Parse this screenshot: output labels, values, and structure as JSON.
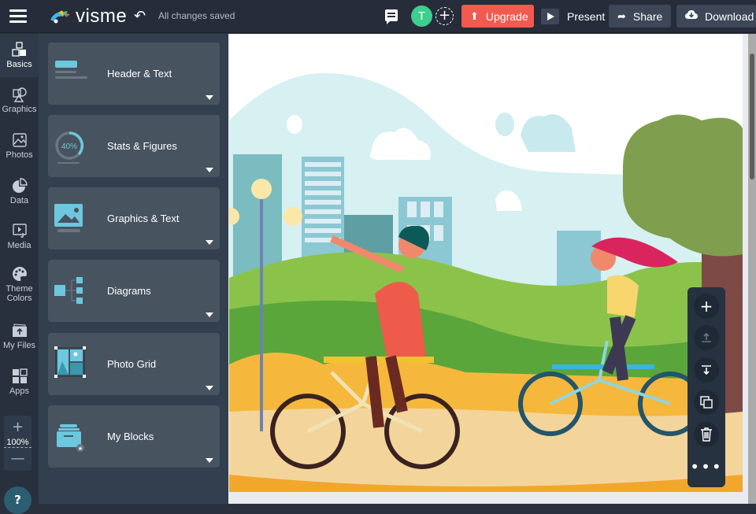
{
  "topbar": {
    "brand": "visme",
    "save_status": "All changes saved",
    "avatar_initial": "T",
    "buttons": {
      "upgrade": "Upgrade",
      "present": "Present",
      "share": "Share",
      "download": "Download"
    },
    "colors": {
      "upgrade": "#f15a4f",
      "avatar": "#3ecf8e"
    }
  },
  "iconbar": {
    "items": [
      {
        "label": "Basics",
        "icon": "blocks-icon",
        "active": true
      },
      {
        "label": "Graphics",
        "icon": "shapes-icon"
      },
      {
        "label": "Photos",
        "icon": "photo-icon"
      },
      {
        "label": "Data",
        "icon": "pie-chart-icon"
      },
      {
        "label": "Media",
        "icon": "media-icon"
      },
      {
        "label": "Theme Colors",
        "label_line1": "Theme",
        "label_line2": "Colors",
        "icon": "palette-icon"
      },
      {
        "label": "My Files",
        "icon": "folder-upload-icon"
      },
      {
        "label": "Apps",
        "icon": "apps-grid-icon"
      }
    ],
    "zoom": {
      "value": "100%",
      "plus": "+",
      "minus": "—"
    },
    "help": "?"
  },
  "panel": {
    "cards": [
      {
        "label": "Header & Text",
        "icon": "header-text-icon"
      },
      {
        "label": "Stats & Figures",
        "icon": "stats-ring-icon",
        "stat": "40%"
      },
      {
        "label": "Graphics & Text",
        "icon": "graphics-text-icon"
      },
      {
        "label": "Diagrams",
        "icon": "diagram-icon"
      },
      {
        "label": "Photo Grid",
        "icon": "photo-grid-icon"
      },
      {
        "label": "My Blocks",
        "icon": "my-blocks-icon"
      }
    ]
  },
  "canvas": {
    "illustration": "Two people riding bicycles in a city park"
  },
  "element_toolbar": {
    "actions": [
      "add",
      "move-forward",
      "move-backward",
      "duplicate",
      "delete",
      "more"
    ],
    "plus": "+",
    "more": "•••"
  }
}
